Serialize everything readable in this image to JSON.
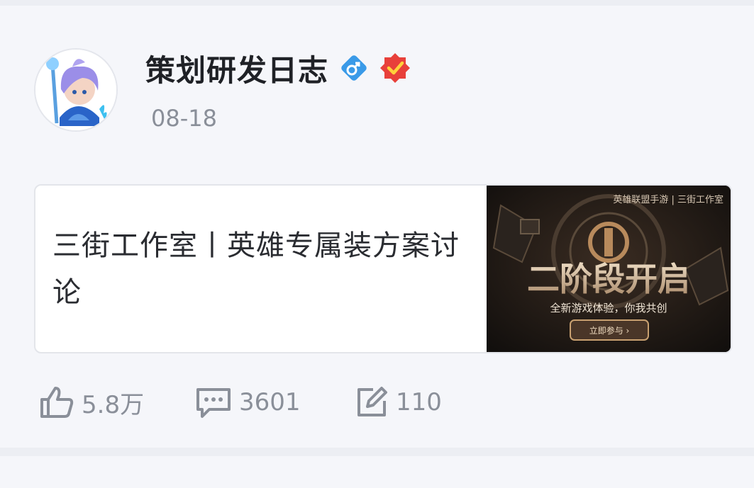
{
  "post": {
    "author": "策划研发日志",
    "gender_icon": "male-badge-icon",
    "verified_icon": "verified-badge-icon",
    "date": "08-18",
    "title": "三街工作室丨英雄专属装方案讨论",
    "thumbnail": {
      "brand_text": "英雄联盟手游 | 三街工作室",
      "headline": "二阶段开启",
      "subtitle": "全新游戏体验，你我共创",
      "button": "立即参与 ›"
    }
  },
  "actions": {
    "likes": "5.8万",
    "comments": "3601",
    "shares": "110"
  },
  "colors": {
    "gender_badge": "#3a9ae8",
    "verified_badge": "#e8403a",
    "gold": "#c8a070"
  }
}
